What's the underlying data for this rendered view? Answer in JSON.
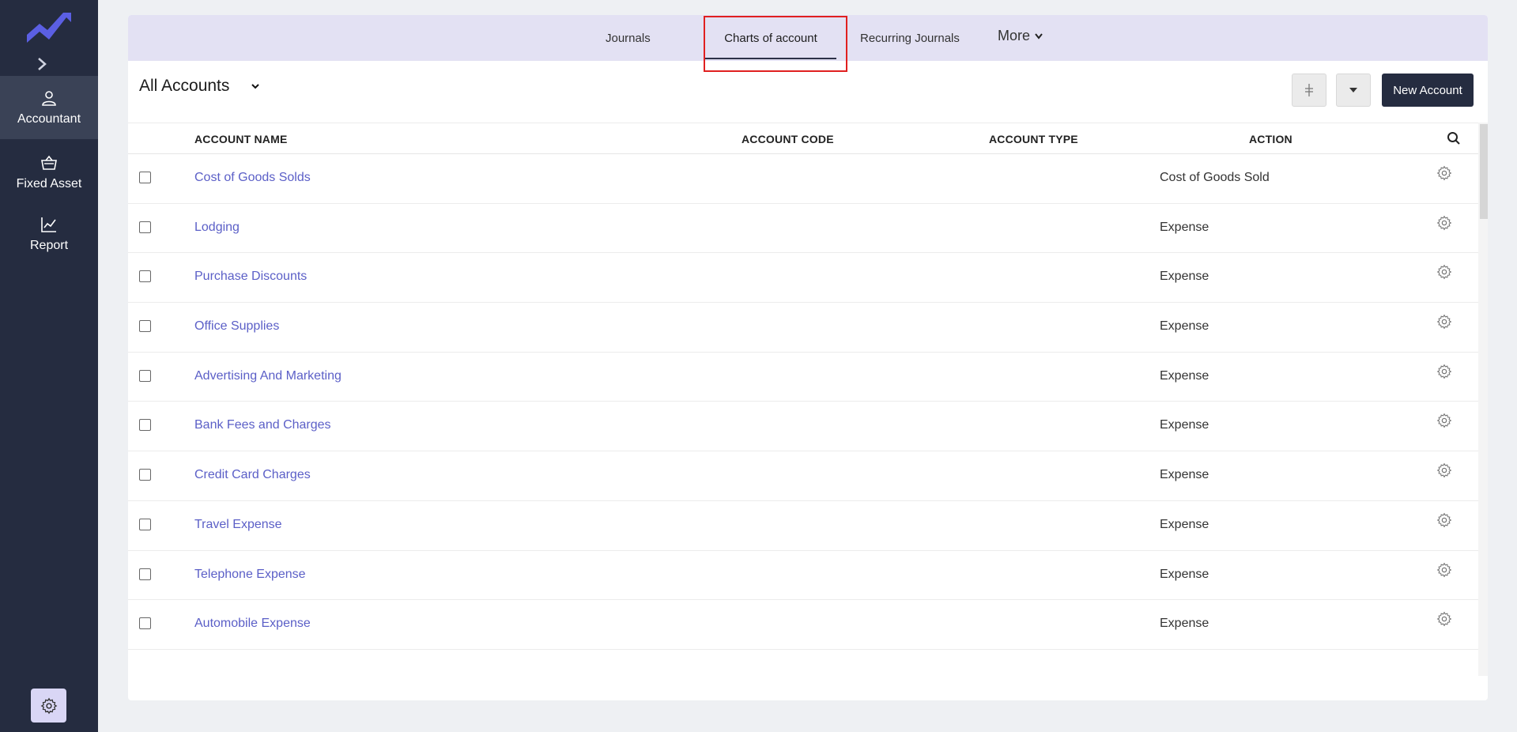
{
  "sidebar": {
    "items": [
      {
        "label": "Accountant",
        "icon": "user-icon",
        "active": true
      },
      {
        "label": "Fixed Asset",
        "icon": "basket-icon",
        "active": false
      },
      {
        "label": "Report",
        "icon": "chart-icon",
        "active": false
      }
    ]
  },
  "tabs": {
    "journals": "Journals",
    "charts": "Charts of account",
    "recurring": "Recurring Journals",
    "more": "More"
  },
  "view": {
    "title": "All Accounts"
  },
  "toolbar": {
    "new_account": "New Account"
  },
  "table": {
    "headers": {
      "name": "ACCOUNT NAME",
      "code": "ACCOUNT CODE",
      "type": "ACCOUNT TYPE",
      "action": "ACTION"
    },
    "rows": [
      {
        "name": "Cost of Goods Solds",
        "type": "Cost of Goods Sold"
      },
      {
        "name": "Lodging",
        "type": "Expense"
      },
      {
        "name": "Purchase Discounts",
        "type": "Expense"
      },
      {
        "name": "Office Supplies",
        "type": "Expense"
      },
      {
        "name": "Advertising And Marketing",
        "type": "Expense"
      },
      {
        "name": "Bank Fees and Charges",
        "type": "Expense"
      },
      {
        "name": "Credit Card Charges",
        "type": "Expense"
      },
      {
        "name": "Travel Expense",
        "type": "Expense"
      },
      {
        "name": "Telephone Expense",
        "type": "Expense"
      },
      {
        "name": "Automobile Expense",
        "type": "Expense"
      }
    ]
  },
  "colors": {
    "sidebar_bg": "#252c40",
    "accent": "#5b5fc7",
    "tabbar_bg": "#e3e1f3",
    "highlight": "#e02020"
  }
}
